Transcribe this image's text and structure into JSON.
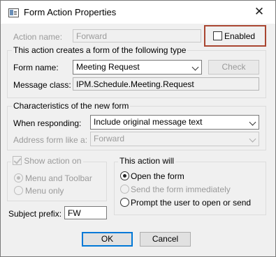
{
  "window": {
    "title": "Form Action Properties",
    "close_glyph": "✕"
  },
  "action_name": {
    "label": "Action name:",
    "value": "Forward"
  },
  "enabled": {
    "label": "Enabled",
    "checked": false
  },
  "form_group": {
    "title": "This action creates a form of the following type",
    "form_name_label": "Form name:",
    "form_name_value": "Meeting Request",
    "check_button": "Check",
    "message_class_label": "Message class:",
    "message_class_value": "IPM.Schedule.Meeting.Request"
  },
  "characteristics": {
    "title": "Characteristics of the new form",
    "when_responding_label": "When responding:",
    "when_responding_value": "Include original message text",
    "address_label": "Address form like a:",
    "address_value": "Forward"
  },
  "show_action": {
    "label": "Show action on",
    "checked": true,
    "options": [
      "Menu and Toolbar",
      "Menu only"
    ],
    "selected": 0
  },
  "this_action_will": {
    "title": "This action will",
    "options": [
      "Open the form",
      "Send the form immediately",
      "Prompt the user to open or send"
    ],
    "selected": 0
  },
  "subject_prefix": {
    "label": "Subject prefix:",
    "value": "FW"
  },
  "buttons": {
    "ok": "OK",
    "cancel": "Cancel"
  }
}
